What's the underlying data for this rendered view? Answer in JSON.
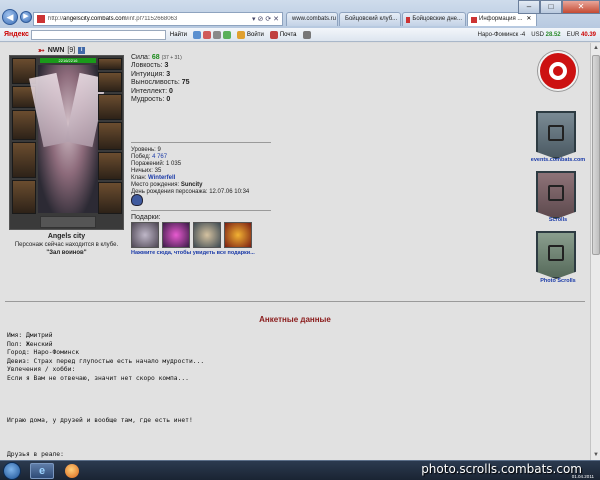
{
  "browser": {
    "url_prefix": "http://",
    "url_host": "angelscity.combats.com",
    "url_path": "/inf.pl?1152668063",
    "addr_actions": "▾ ⊘ ⟳ ✕",
    "tabs": [
      {
        "label": "www.combats.ru ..."
      },
      {
        "label": "Бойцовский клуб..."
      },
      {
        "label": "Бойцовские дне..."
      },
      {
        "label": "Информация ..."
      }
    ],
    "minimize": "–",
    "maximize": "□",
    "close": "✕"
  },
  "toolbar": {
    "yandex_label": "Яндекс",
    "find_label": "Найти",
    "login_label": "Войти",
    "mail_label": "Почта",
    "city_weather": "Наро-Фоминск",
    "temp": "-4",
    "usd": "USD",
    "usd_val": "28.52",
    "eur": "EUR",
    "eur_val": "40.39"
  },
  "character": {
    "name": "NWN",
    "level": "[9]",
    "hp": "2216/2216",
    "clan_city": "Angels city",
    "location": "Персонаж сейчас находится в клубе.",
    "room": "\"Зал воинов\""
  },
  "stats": {
    "strength_label": "Сила:",
    "strength_value": "68",
    "strength_extra": "(37 + 31)",
    "agility_label": "Ловкость:",
    "agility_value": "3",
    "intuition_label": "Интуиция:",
    "intuition_value": "3",
    "endurance_label": "Выносливость:",
    "endurance_value": "75",
    "intellect_label": "Интеллект:",
    "intellect_value": "0",
    "wisdom_label": "Мудрость:",
    "wisdom_value": "0"
  },
  "info": {
    "level_label": "Уровень:",
    "level_value": "9",
    "wins_label": "Побед:",
    "wins_value": "4 767",
    "losses_label": "Поражений:",
    "losses_value": "1 035",
    "draws_label": "Ничьих:",
    "draws_value": "35",
    "clan_label": "Клан:",
    "clan_value": "Winterfell",
    "birthplace_label": "Место рождения:",
    "birthplace_value": "Suncity",
    "birthday_label": "День рождения персонажа:",
    "birthday_value": "12.07.06 10:34"
  },
  "gifts": {
    "title": "Подарки:",
    "link": "Нажмите сюда, чтобы увидеть все подарки..."
  },
  "sidebar": {
    "events_label": "events.combats.com",
    "scrolls_label": "Scrolls",
    "photo_label": "Photo Scrolls"
  },
  "anketa": {
    "title": "Анкетные данные",
    "text": "Имя: Дмитрий\nПол: Женский\nГород: Наро-Фоминск\nДевиз: Страх перед глупостью есть начало мудрости...\nУвлечения / хобби:\nЕсли я Вам не отвечаю, значит нет скоро компа...\n\n\n\n\nИграю дома, у друзей и вообще там, где есть инет!\n\n\n\nДрузья в реале:\nкосматый жук\nритузы"
  },
  "watermark": "photo.scrolls.combats.com",
  "watermark_date": "01.04.2011",
  "colors": {
    "accent_red": "#cc1111",
    "link_blue": "#1a3aa8",
    "title_dark_red": "#8a1a1a",
    "stat_green": "#1a8a1a"
  }
}
